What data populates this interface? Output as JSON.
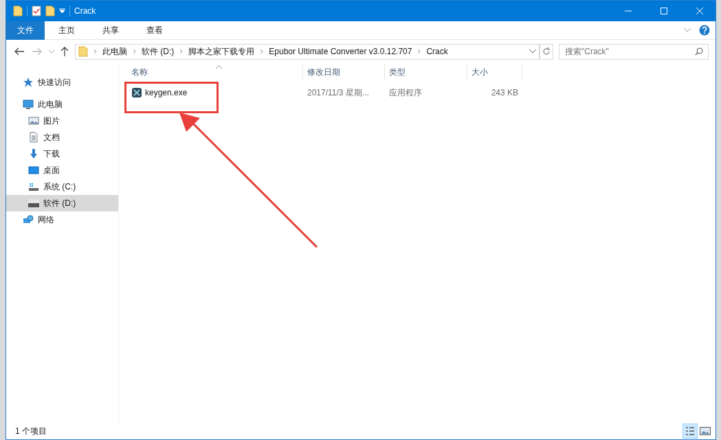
{
  "window": {
    "title": "Crack"
  },
  "ribbon_tabs": [
    {
      "label": "文件",
      "selected": true
    },
    {
      "label": "主页",
      "selected": false
    },
    {
      "label": "共享",
      "selected": false
    },
    {
      "label": "查看",
      "selected": false
    }
  ],
  "breadcrumb": [
    "此电脑",
    "软件 (D:)",
    "脚本之家下载专用",
    "Epubor Ultimate Converter v3.0.12.707",
    "Crack"
  ],
  "search": {
    "placeholder": "搜索\"Crack\""
  },
  "sidebar": [
    {
      "label": "快速访问",
      "kind": "star",
      "selected": false
    },
    {
      "label": "此电脑",
      "kind": "pc",
      "selected": false,
      "children": [
        {
          "label": "图片",
          "kind": "pictures",
          "selected": false
        },
        {
          "label": "文档",
          "kind": "documents",
          "selected": false
        },
        {
          "label": "下载",
          "kind": "downloads",
          "selected": false
        },
        {
          "label": "桌面",
          "kind": "desktop",
          "selected": false
        },
        {
          "label": "系统 (C:)",
          "kind": "sysdrive",
          "selected": false
        },
        {
          "label": "软件 (D:)",
          "kind": "drive",
          "selected": true
        }
      ]
    },
    {
      "label": "网络",
      "kind": "network",
      "selected": false
    }
  ],
  "table": {
    "columns": [
      "名称",
      "修改日期",
      "类型",
      "大小"
    ],
    "rows": [
      {
        "name": "keygen.exe",
        "modified": "2017/11/3 星期...",
        "type": "应用程序",
        "size": "243 KB"
      }
    ]
  },
  "status_bar": {
    "text": "1 个项目",
    "views": [
      {
        "kind": "details",
        "selected": true
      },
      {
        "kind": "thumbnails",
        "selected": false
      }
    ]
  }
}
